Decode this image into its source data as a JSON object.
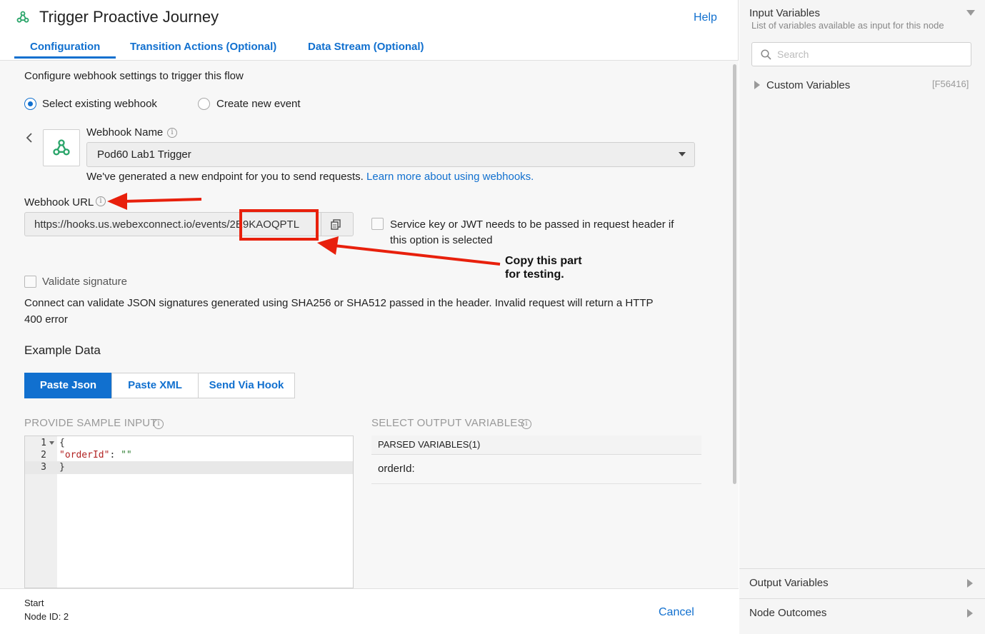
{
  "header": {
    "title": "Trigger Proactive Journey",
    "help": "Help"
  },
  "tabs": [
    {
      "label": "Configuration",
      "active": true
    },
    {
      "label": "Transition Actions (Optional)"
    },
    {
      "label": "Data Stream (Optional)"
    }
  ],
  "config": {
    "intro": "Configure webhook settings to trigger this flow",
    "radio_existing": "Select existing webhook",
    "radio_new": "Create new event",
    "webhook_name_label": "Webhook Name",
    "webhook_name_value": "Pod60 Lab1 Trigger",
    "endpoint_note": "We've generated a new endpoint for you to send requests.",
    "learn_more": "Learn more about using webhooks.",
    "webhook_url_label": "Webhook URL",
    "webhook_url_prefix": "https://hooks.us.webexconnect.io/events/",
    "webhook_url_id": "2E9KAOQPTL",
    "service_key_text_1": "Service key or JWT needs to be passed in request header if",
    "service_key_text_2": "this option is selected",
    "validate_label": "Validate signature",
    "validate_desc_1": "Connect can validate JSON signatures generated using SHA256 or SHA512 passed in the header. Invalid request will return a HTTP",
    "validate_desc_2": "400 error",
    "example_data_heading": "Example Data",
    "segments": [
      "Paste Json",
      "Paste XML",
      "Send Via Hook"
    ],
    "sample_input_label": "PROVIDE SAMPLE INPUT",
    "output_vars_label": "SELECT OUTPUT VARIABLES",
    "parsed_header": "PARSED VARIABLES(1)",
    "parsed_item": "orderId:",
    "code_lines": [
      {
        "num": "1",
        "text": "{"
      },
      {
        "num": "2",
        "key": "\"orderId\"",
        "sep": ": ",
        "val": "\"\""
      },
      {
        "num": "3",
        "text": "}"
      }
    ]
  },
  "annotation": {
    "line1": "Copy this part",
    "line2": "for testing."
  },
  "footer": {
    "node_type": "Start",
    "node_id": "Node ID: 2",
    "cancel": "Cancel"
  },
  "right_panel": {
    "title": "Input Variables",
    "subtitle": "List of variables available as input for this node",
    "search_placeholder": "Search",
    "custom_variables": "Custom Variables",
    "custom_code": "[F56416]",
    "output_variables": "Output Variables",
    "node_outcomes": "Node Outcomes"
  },
  "colors": {
    "accent": "#1170cf",
    "annotation_red": "#e8200c",
    "webhook_green": "#2aa56a"
  }
}
